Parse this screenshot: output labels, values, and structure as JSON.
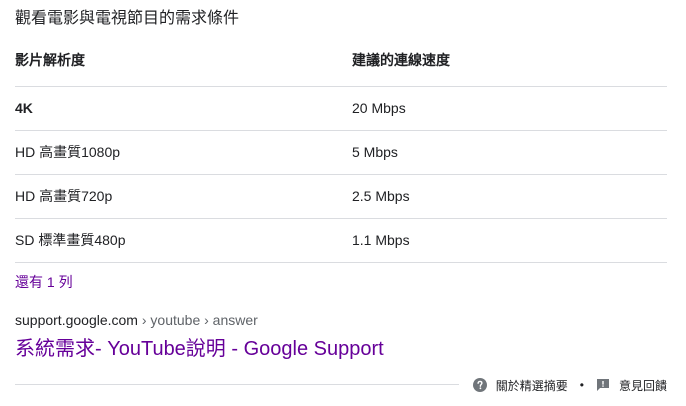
{
  "heading": "觀看電影與電視節目的需求條件",
  "table": {
    "headers": [
      "影片解析度",
      "建議的連線速度"
    ],
    "rows": [
      [
        "4K",
        "20 Mbps"
      ],
      [
        "HD 高畫質1080p",
        "5 Mbps"
      ],
      [
        "HD 高畫質720p",
        "2.5 Mbps"
      ],
      [
        "SD 標準畫質480p",
        "1.1 Mbps"
      ]
    ]
  },
  "more_rows_label": "還有 1 列",
  "result": {
    "cite_domain": "support.google.com",
    "cite_path": " › youtube › answer",
    "title": "系統需求- YouTube說明 - Google Support"
  },
  "footer": {
    "about_label": "關於精選摘要",
    "feedback_label": "意見回饋",
    "separator": "•",
    "about_icon": "help-circle-icon",
    "feedback_icon": "feedback-icon"
  },
  "colors": {
    "visited_link": "#660099",
    "divider": "#dadce0",
    "text": "#202124",
    "secondary_text": "#5f6368"
  }
}
